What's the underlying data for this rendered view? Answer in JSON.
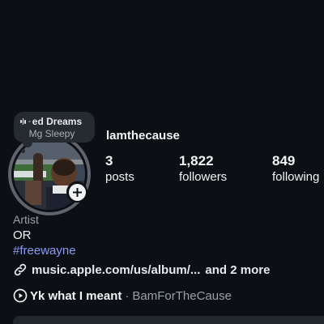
{
  "note": {
    "song_fragment": "ed Dreams",
    "artist": "Mg Sleepy",
    "icon": "audio-wave-icon"
  },
  "profile": {
    "username": "lamthecause",
    "avatar_icon": "profile-photo",
    "add_icon": "plus-icon"
  },
  "stats": [
    {
      "value": "3",
      "label": "posts"
    },
    {
      "value": "1,822",
      "label": "followers"
    },
    {
      "value": "849",
      "label": "following"
    }
  ],
  "bio": {
    "category": "Artist",
    "text": "OR",
    "hashtag": "#freewayne",
    "link": "music.apple.com/us/album/...",
    "link_more": "and 2 more",
    "link_icon": "link-icon"
  },
  "music": {
    "song": "Yk what I meant",
    "separator": "·",
    "artist": "BamForTheCause",
    "icon": "play-circle-icon"
  },
  "colors": {
    "background": "#0c0f14",
    "hashtag": "#8c9cf5",
    "secondary_text": "#9aa0a8",
    "bubble": "#262a31"
  }
}
